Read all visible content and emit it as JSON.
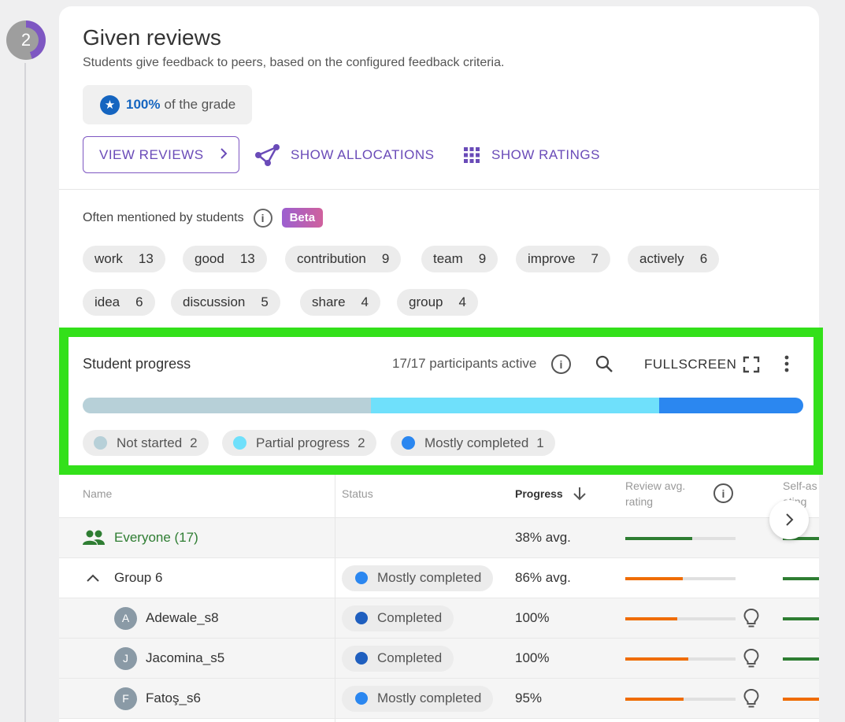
{
  "step": {
    "number": "2"
  },
  "section": {
    "title": "Given reviews",
    "subtitle": "Students give feedback to peers, based on the configured feedback criteria.",
    "grade_pct": "100%",
    "grade_rest": "of the grade"
  },
  "actions": {
    "view_reviews": "VIEW REVIEWS",
    "show_allocations": "SHOW ALLOCATIONS",
    "show_ratings": "SHOW RATINGS"
  },
  "mentioned": {
    "label": "Often mentioned by students",
    "badge": "Beta",
    "keywords": [
      {
        "word": "work",
        "count": "13"
      },
      {
        "word": "good",
        "count": "13"
      },
      {
        "word": "contribution",
        "count": "9"
      },
      {
        "word": "team",
        "count": "9"
      },
      {
        "word": "improve",
        "count": "7"
      },
      {
        "word": "actively",
        "count": "6"
      },
      {
        "word": "idea",
        "count": "6"
      },
      {
        "word": "discussion",
        "count": "5"
      },
      {
        "word": "share",
        "count": "4"
      },
      {
        "word": "group",
        "count": "4"
      }
    ]
  },
  "progress": {
    "title": "Student progress",
    "active": "17/17 participants active",
    "fullscreen": "FULLSCREEN",
    "segments": [
      {
        "label": "Not started",
        "count": "2",
        "share": 0.4,
        "color": "#b7d0d8"
      },
      {
        "label": "Partial progress",
        "count": "2",
        "share": 0.4,
        "color": "#6fe0fb"
      },
      {
        "label": "Mostly completed",
        "count": "1",
        "share": 0.2,
        "color": "#2b87f0"
      }
    ]
  },
  "table": {
    "headers": {
      "name": "Name",
      "status": "Status",
      "progress": "Progress",
      "review_avg_1": "Review avg.",
      "review_avg_2": "rating",
      "self_1": "Self-as",
      "self_2": "ating"
    },
    "rows": [
      {
        "name": "Everyone (17)",
        "status": "",
        "progress": "38% avg.",
        "review": 0.61,
        "review_color": "#2e7d32",
        "self_color": "#2e7d32"
      },
      {
        "name": "Group 6",
        "status": "Mostly completed",
        "status_color": "#2b87f0",
        "progress": "86% avg.",
        "review": 0.52,
        "review_color": "#ef6c00",
        "self_color": "#2e7d32"
      },
      {
        "name": "Adewale_s8",
        "initial": "A",
        "status": "Completed",
        "status_color": "#1f5fbf",
        "progress": "100%",
        "review": 0.47,
        "review_color": "#ef6c00",
        "self_color": "#2e7d32"
      },
      {
        "name": "Jacomina_s5",
        "initial": "J",
        "status": "Completed",
        "status_color": "#1f5fbf",
        "progress": "100%",
        "review": 0.57,
        "review_color": "#ef6c00",
        "self_color": "#2e7d32"
      },
      {
        "name": "Fatoş_s6",
        "initial": "F",
        "status": "Mostly completed",
        "status_color": "#2b87f0",
        "progress": "95%",
        "review": 0.53,
        "review_color": "#ef6c00",
        "self_color": "#ef6c00"
      }
    ]
  }
}
